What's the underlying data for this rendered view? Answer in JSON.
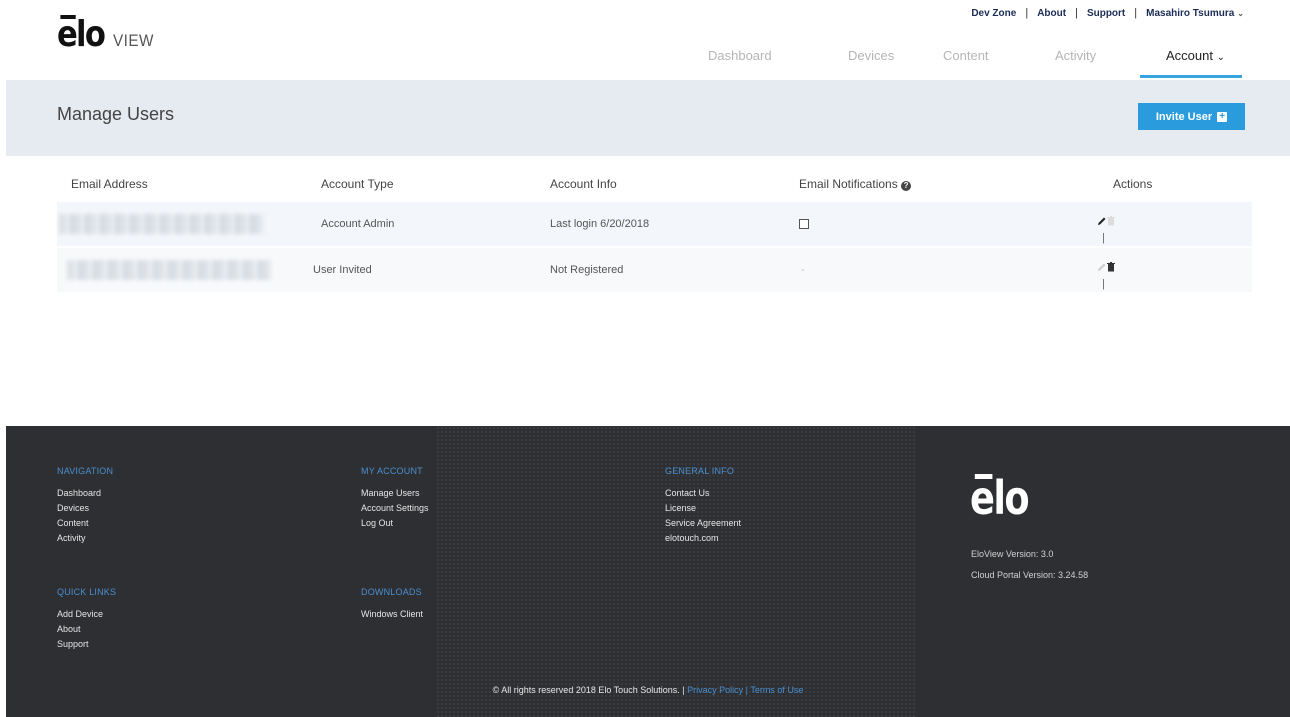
{
  "brand": {
    "logo_main": "elo",
    "logo_sub": "VIEW"
  },
  "utility_nav": {
    "dev_zone": "Dev Zone",
    "about": "About",
    "support": "Support",
    "user": "Masahiro Tsumura"
  },
  "main_nav": {
    "dashboard": "Dashboard",
    "devices": "Devices",
    "content": "Content",
    "activity": "Activity",
    "account": "Account",
    "active": "Account"
  },
  "page": {
    "title": "Manage Users",
    "invite_button": "Invite User",
    "accent_color": "#2a9cde"
  },
  "table": {
    "headers": {
      "email": "Email Address",
      "type": "Account Type",
      "info": "Account Info",
      "notifications": "Email Notifications",
      "actions": "Actions"
    },
    "rows": [
      {
        "email": "",
        "type": "Account Admin",
        "info": "Last login 6/20/2018",
        "notifications": "",
        "edit_enabled": true,
        "delete_enabled": false
      },
      {
        "email": "",
        "type": "User Invited",
        "info": "Not Registered",
        "notifications": "-",
        "edit_enabled": false,
        "delete_enabled": true
      }
    ]
  },
  "footer": {
    "navigation": {
      "heading": "NAVIGATION",
      "links": [
        "Dashboard",
        "Devices",
        "Content",
        "Activity"
      ]
    },
    "quick_links": {
      "heading": "QUICK LINKS",
      "links": [
        "Add Device",
        "About",
        "Support"
      ]
    },
    "my_account": {
      "heading": "MY ACCOUNT",
      "links": [
        "Manage Users",
        "Account Settings",
        "Log Out"
      ]
    },
    "downloads": {
      "heading": "DOWNLOADS",
      "links": [
        "Windows Client"
      ]
    },
    "general_info": {
      "heading": "GENERAL INFO",
      "links": [
        "Contact Us",
        "License",
        "Service Agreement",
        "elotouch.com"
      ]
    },
    "logo": "elo",
    "eloview_version": "EloView Version: 3.0",
    "cloud_version": "Cloud Portal Version: 3.24.58",
    "copyright": "© All rights reserved 2018 Elo Touch Solutions. |",
    "privacy": "Privacy Policy",
    "pipe": "|",
    "terms": "Terms of Use"
  }
}
